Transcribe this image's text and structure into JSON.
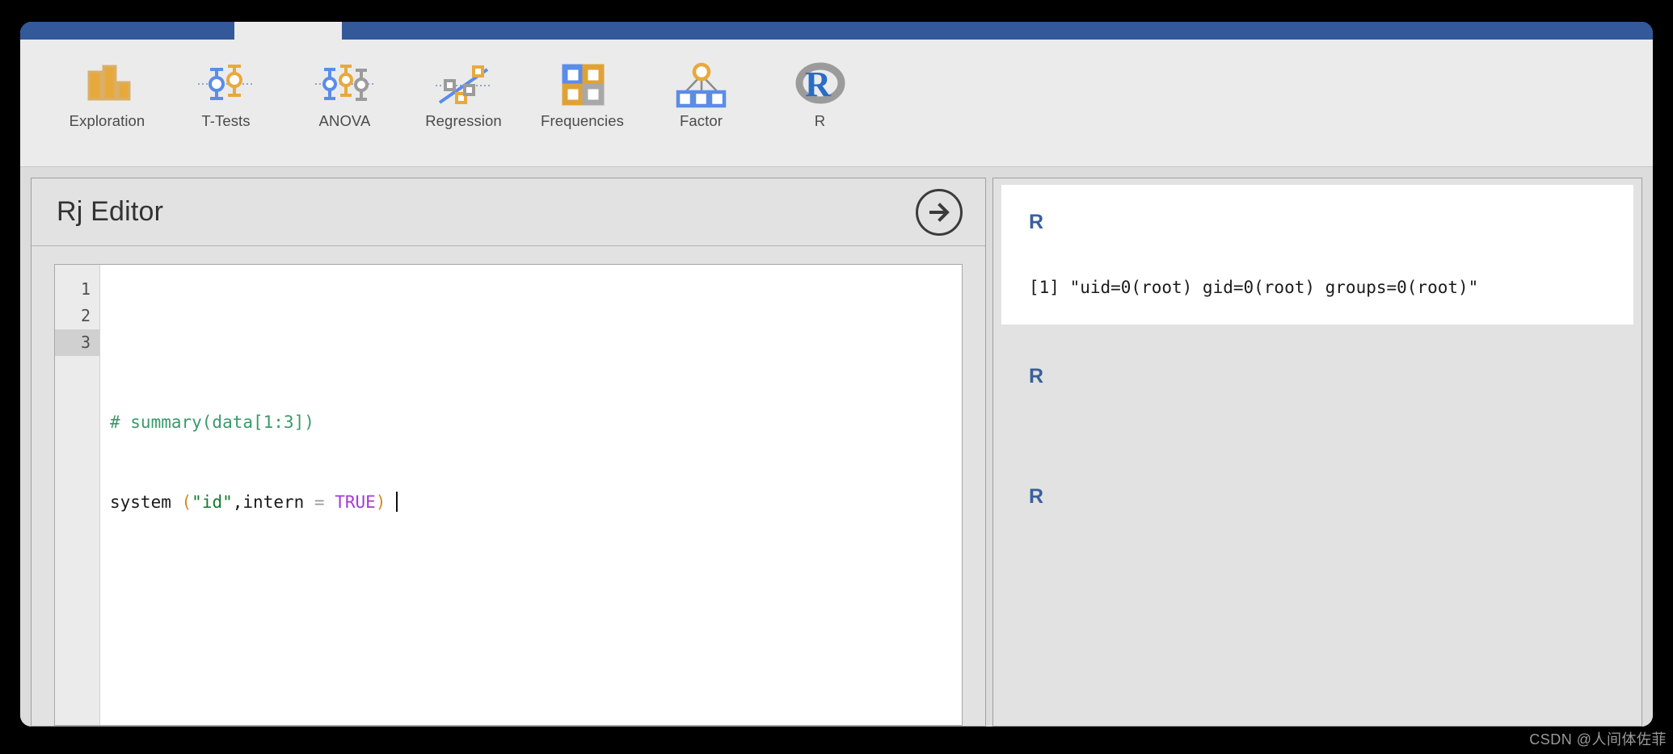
{
  "window": {
    "background_color": "#000000",
    "chrome_color": "#ebebeb"
  },
  "tab_strip": {
    "accent_color": "#3a5f9e",
    "active_tab_color": "#ebebeb"
  },
  "ribbon": {
    "items": [
      {
        "label": "Exploration",
        "icon": "bar-chart-icon"
      },
      {
        "label": "T-Tests",
        "icon": "t-tests-icon"
      },
      {
        "label": "ANOVA",
        "icon": "anova-icon"
      },
      {
        "label": "Regression",
        "icon": "regression-icon"
      },
      {
        "label": "Frequencies",
        "icon": "frequencies-icon"
      },
      {
        "label": "Factor",
        "icon": "factor-icon"
      },
      {
        "label": "R",
        "icon": "r-logo-icon"
      }
    ]
  },
  "options_panel": {
    "title": "Rj Editor",
    "run_button_icon": "arrow-right-circle-icon"
  },
  "editor": {
    "line_numbers": [
      "1",
      "2",
      "3"
    ],
    "current_line": 3,
    "lines": [
      {
        "n": 1,
        "tokens": []
      },
      {
        "n": 2,
        "tokens": [
          {
            "t": "# summary(data[1:3])",
            "c": "comment"
          }
        ]
      },
      {
        "n": 3,
        "tokens": [
          {
            "t": "system ",
            "c": "fn"
          },
          {
            "t": "(",
            "c": "paren"
          },
          {
            "t": "\"id\"",
            "c": "string"
          },
          {
            "t": ",",
            "c": "punct"
          },
          {
            "t": "intern ",
            "c": "arg"
          },
          {
            "t": "= ",
            "c": "op"
          },
          {
            "t": "TRUE",
            "c": "const"
          },
          {
            "t": ")",
            "c": "paren"
          }
        ]
      }
    ],
    "line2_text": "# summary(data[1:3])",
    "line3_text": "system (\"id\",intern = TRUE)"
  },
  "results": {
    "blocks": [
      {
        "heading": "R",
        "output": "[1] \"uid=0(root) gid=0(root) groups=0(root)\"",
        "white": true
      },
      {
        "heading": "R",
        "output": "",
        "white": false
      },
      {
        "heading": "R",
        "output": "",
        "white": false
      }
    ],
    "heading_color": "#3a5f9e"
  },
  "watermark": {
    "text": "CSDN @人间体佐菲"
  }
}
